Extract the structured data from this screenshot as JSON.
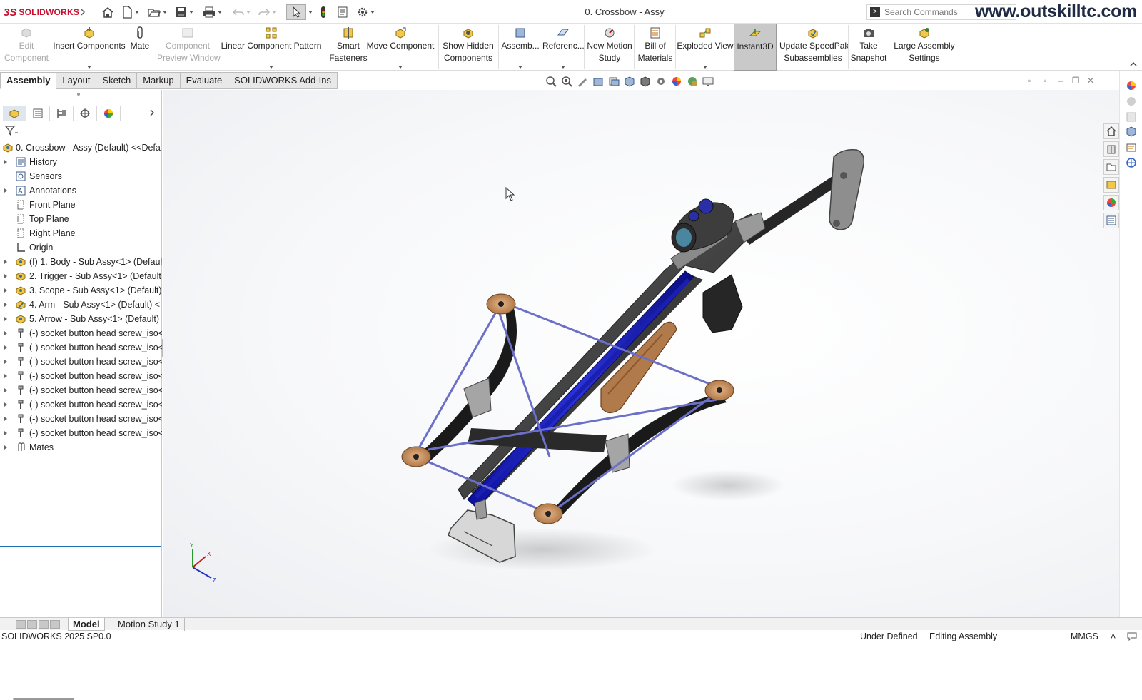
{
  "app": {
    "brand_ds": "3S",
    "brand_name": "SOLIDWORKS",
    "document_title": "0. Crossbow - Assy",
    "watermark": "www.outskilltc.com"
  },
  "search": {
    "placeholder": "Search Commands"
  },
  "quick_access": [
    {
      "icon": "home-icon"
    },
    {
      "icon": "new-document-icon"
    },
    {
      "icon": "open-folder-icon"
    },
    {
      "icon": "save-icon"
    },
    {
      "icon": "print-icon"
    },
    {
      "icon": "undo-icon"
    },
    {
      "icon": "redo-icon"
    },
    {
      "icon": "select-arrow-icon"
    },
    {
      "icon": "rebuild-icon"
    },
    {
      "icon": "file-properties-icon"
    },
    {
      "icon": "options-gear-icon"
    }
  ],
  "commands": [
    {
      "line1": "Edit",
      "line2": "Component",
      "disabled": true
    },
    {
      "line1": "Insert Components",
      "line2": "",
      "dropdown": true
    },
    {
      "line1": "Mate",
      "line2": ""
    },
    {
      "line1": "Component",
      "line2": "Preview Window",
      "disabled": true
    },
    {
      "line1": "Linear Component Pattern",
      "line2": "",
      "dropdown": true
    },
    {
      "line1": "Smart",
      "line2": "Fasteners"
    },
    {
      "line1": "Move Component",
      "line2": "",
      "dropdown": true
    },
    {
      "line1": "Show Hidden",
      "line2": "Components"
    },
    {
      "line1": "Assemb...",
      "line2": "",
      "dropdown": true
    },
    {
      "line1": "Referenc...",
      "line2": "",
      "dropdown": true
    },
    {
      "line1": "New Motion",
      "line2": "Study"
    },
    {
      "line1": "Bill of",
      "line2": "Materials"
    },
    {
      "line1": "Exploded View",
      "line2": "",
      "dropdown": true
    },
    {
      "line1": "Instant3D",
      "line2": "",
      "active": true
    },
    {
      "line1": "Update SpeedPak",
      "line2": "Subassemblies"
    },
    {
      "line1": "Take",
      "line2": "Snapshot"
    },
    {
      "line1": "Large Assembly",
      "line2": "Settings"
    }
  ],
  "tabs": [
    "Assembly",
    "Layout",
    "Sketch",
    "Markup",
    "Evaluate",
    "SOLIDWORKS Add-Ins"
  ],
  "active_tab": "Assembly",
  "tree": {
    "root": "0. Crossbow - Assy (Default) <<Defa",
    "items": [
      {
        "label": "History",
        "icon": "history-icon",
        "expandable": true
      },
      {
        "label": "Sensors",
        "icon": "sensors-icon",
        "expandable": false
      },
      {
        "label": "Annotations",
        "icon": "annotations-icon",
        "expandable": true
      },
      {
        "label": "Front Plane",
        "icon": "plane-icon",
        "expandable": false
      },
      {
        "label": "Top Plane",
        "icon": "plane-icon",
        "expandable": false
      },
      {
        "label": "Right Plane",
        "icon": "plane-icon",
        "expandable": false
      },
      {
        "label": "Origin",
        "icon": "origin-icon",
        "expandable": false
      },
      {
        "label": "(f) 1. Body - Sub Assy<1> (Defaul",
        "icon": "subassembly-icon",
        "expandable": true
      },
      {
        "label": "2. Trigger - Sub Assy<1> (Default",
        "icon": "subassembly-icon",
        "expandable": true
      },
      {
        "label": "3. Scope - Sub Assy<1> (Default)",
        "icon": "subassembly-icon",
        "expandable": true
      },
      {
        "label": "4. Arm - Sub Assy<1> (Default) <",
        "icon": "subassembly-flexible-icon",
        "expandable": true
      },
      {
        "label": "5. Arrow - Sub Assy<1> (Default)",
        "icon": "subassembly-icon",
        "expandable": true
      },
      {
        "label": "(-) socket button head screw_iso<",
        "icon": "screw-part-icon",
        "expandable": true
      },
      {
        "label": "(-) socket button head screw_iso<",
        "icon": "screw-part-icon",
        "expandable": true
      },
      {
        "label": "(-) socket button head screw_iso<",
        "icon": "screw-part-icon",
        "expandable": true
      },
      {
        "label": "(-) socket button head screw_iso<",
        "icon": "screw-part-icon",
        "expandable": true
      },
      {
        "label": "(-) socket button head screw_iso<",
        "icon": "screw-part-icon",
        "expandable": true
      },
      {
        "label": "(-) socket button head screw_iso<",
        "icon": "screw-part-icon",
        "expandable": true
      },
      {
        "label": "(-) socket button head screw_iso<",
        "icon": "screw-part-icon",
        "expandable": true
      },
      {
        "label": "(-) socket button head screw_iso<",
        "icon": "screw-part-icon",
        "expandable": true
      },
      {
        "label": "Mates",
        "icon": "mates-icon",
        "expandable": true
      }
    ]
  },
  "triad": {
    "x": "X",
    "y": "Y",
    "z": "Z"
  },
  "bottom_tabs": [
    "Model",
    "Motion Study 1"
  ],
  "active_bottom_tab": "Model",
  "status": {
    "version": "SOLIDWORKS 2025 SP0.0",
    "definition": "Under Defined",
    "mode": "Editing Assembly",
    "units": "MMGS"
  },
  "colors": {
    "brand": "#c8102e",
    "rail_blue": "#1a1fb0",
    "string": "#6b6fc6",
    "wood": "#b07a4a",
    "selection_blue": "#1f6fb5"
  }
}
